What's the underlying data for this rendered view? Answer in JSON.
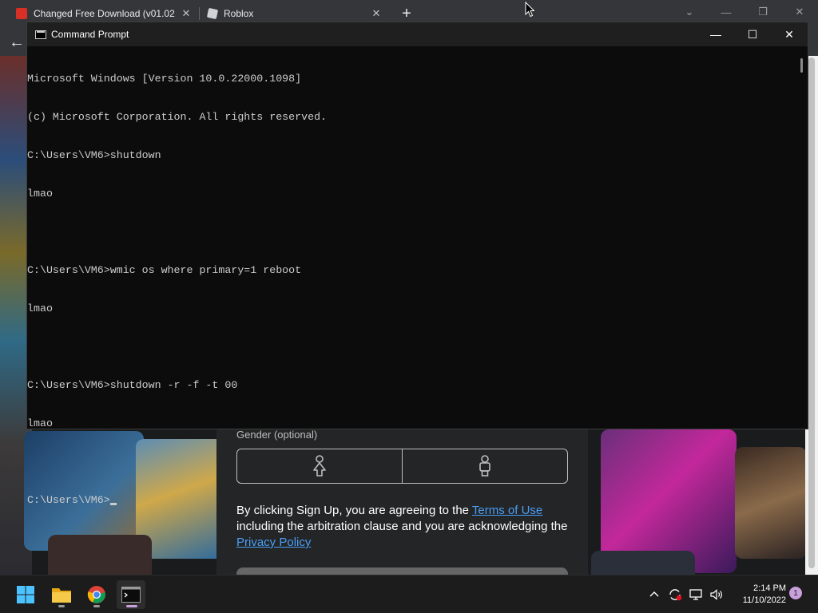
{
  "browser": {
    "tabs": [
      {
        "title": "Changed Free Download (v01.02",
        "close": "✕"
      },
      {
        "title": "Roblox",
        "close": "✕"
      }
    ],
    "new_tab": "+",
    "window_controls": {
      "dropdown": "⌄",
      "minimize": "—",
      "restore": "❐",
      "close": "✕"
    },
    "back": "←"
  },
  "roblox": {
    "gender_label": "Gender (optional)",
    "legal_prefix": "By clicking Sign Up, you are agreeing to the ",
    "terms_link": "Terms of Use",
    "legal_middle": " including the arbitration clause and you are acknowledging the ",
    "privacy_link": "Privacy Policy"
  },
  "cmd": {
    "title": "Command Prompt",
    "controls": {
      "minimize": "—",
      "maximize": "☐",
      "close": "✕"
    },
    "lines": [
      "Microsoft Windows [Version 10.0.22000.1098]",
      "(c) Microsoft Corporation. All rights reserved.",
      "C:\\Users\\VM6>shutdown",
      "lmao",
      "",
      "C:\\Users\\VM6>wmic os where primary=1 reboot",
      "lmao",
      "",
      "C:\\Users\\VM6>shutdown -r -f -t 00",
      "lmao",
      "",
      "C:\\Users\\VM6>"
    ]
  },
  "taskbar": {
    "apps": [
      "start-icon",
      "file-explorer-icon",
      "chrome-icon",
      "terminal-icon"
    ],
    "time": "2:14 PM",
    "date": "11/10/2022",
    "notification_count": "1"
  },
  "colors": {
    "cmd_bg": "#0c0c0c",
    "cmd_text": "#cccccc",
    "link": "#4a9ff5",
    "accent": "#c9a0dc"
  }
}
